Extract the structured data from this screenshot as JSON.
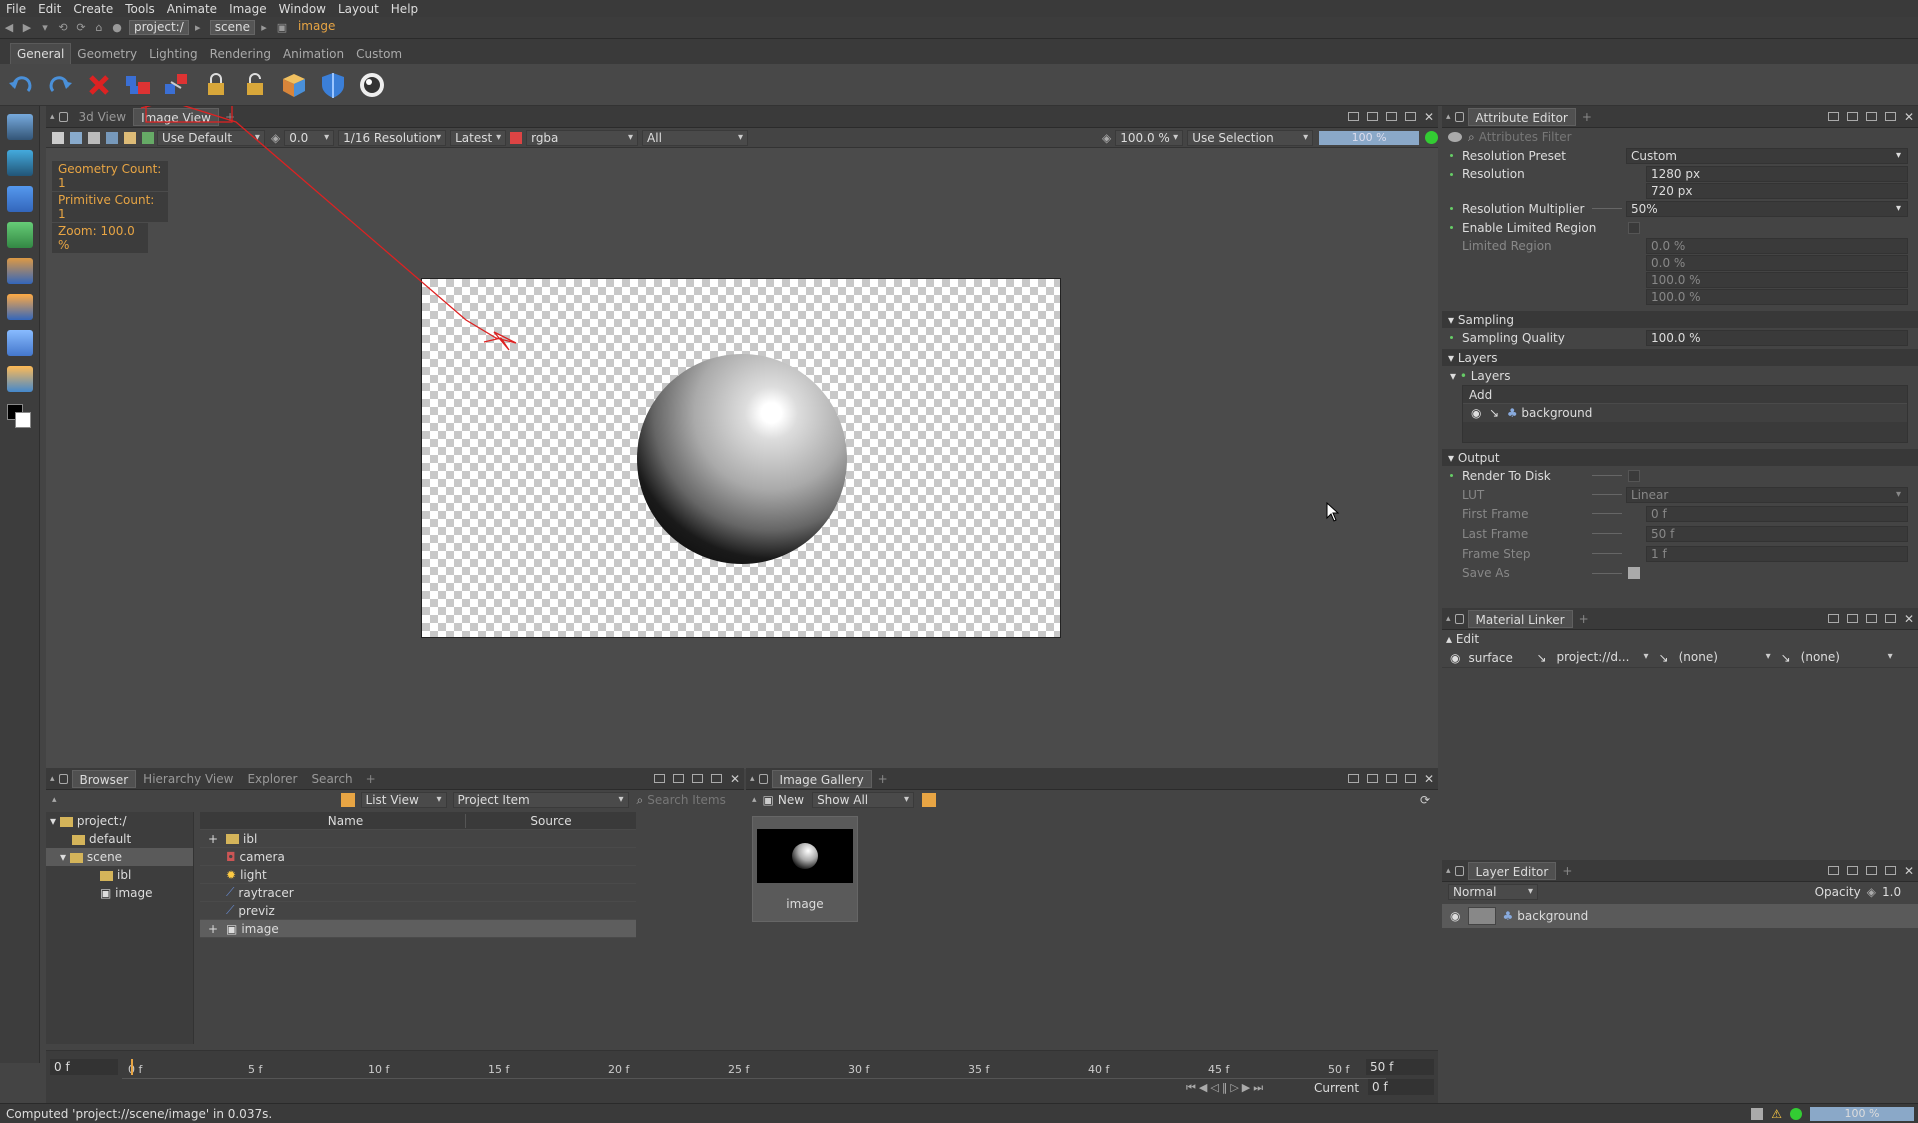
{
  "menu": [
    "File",
    "Edit",
    "Create",
    "Tools",
    "Animate",
    "Image",
    "Window",
    "Layout",
    "Help"
  ],
  "breadcrumb": [
    "project:/",
    "scene",
    "image"
  ],
  "shelf_tabs": [
    "General",
    "Geometry",
    "Lighting",
    "Rendering",
    "Animation",
    "Custom"
  ],
  "viewport": {
    "tabs": [
      "3d View",
      "Image View"
    ],
    "toolbar": {
      "camera": "Use Default",
      "exposure": "0.0",
      "resolution": "1/16 Resolution",
      "version": "Latest",
      "channels": "rgba",
      "layer": "All",
      "zoom": "100.0 %",
      "selection": "Use Selection",
      "progress": "100 %"
    },
    "info": [
      "Geometry Count: 1",
      "Primitive Count: 1",
      "Zoom: 100.0 %"
    ]
  },
  "attr": {
    "tab": "Attribute Editor",
    "filter_placeholder": "Attributes Filter",
    "resolution_preset_label": "Resolution Preset",
    "resolution_preset": "Custom",
    "resolution_label": "Resolution",
    "res_w": "1280 px",
    "res_h": "720 px",
    "multiplier_label": "Resolution Multiplier",
    "multiplier": "50%",
    "limited_enable_label": "Enable Limited Region",
    "limited_label": "Limited Region",
    "limited": [
      "0.0 %",
      "0.0 %",
      "100.0 %",
      "100.0 %"
    ],
    "sampling_section": "Sampling",
    "sampling_label": "Sampling Quality",
    "sampling": "100.0 %",
    "layers_section": "Layers",
    "layers_sub": "Layers",
    "add": "Add",
    "layer_item": "background",
    "output_section": "Output",
    "render_disk_label": "Render To Disk",
    "lut_label": "LUT",
    "lut": "Linear",
    "first_frame_label": "First Frame",
    "first_frame": "0 f",
    "last_frame_label": "Last Frame",
    "last_frame": "50 f",
    "frame_step_label": "Frame Step",
    "frame_step": "1 f",
    "save_as_label": "Save As"
  },
  "matlinker": {
    "tab": "Material Linker",
    "edit": "Edit",
    "surface": "surface",
    "project": "project://d...",
    "none1": "(none)",
    "none2": "(none)"
  },
  "layereditor": {
    "tab": "Layer Editor",
    "blend": "Normal",
    "opacity_label": "Opacity",
    "opacity": "1.0",
    "layer": "background"
  },
  "browser": {
    "tabs": [
      "Browser",
      "Hierarchy View",
      "Explorer",
      "Search"
    ],
    "view": "List View",
    "filter": "Project Item",
    "search_placeholder": "Search Items",
    "tree": [
      "project:/",
      "default",
      "scene",
      "ibl",
      "image"
    ],
    "col_name": "Name",
    "col_source": "Source",
    "items": [
      "ibl",
      "camera",
      "light",
      "raytracer",
      "previz",
      "image"
    ]
  },
  "gallery": {
    "tab": "Image Gallery",
    "new": "New",
    "show": "Show All",
    "thumb_label": "image"
  },
  "timeline": {
    "start": "0 f",
    "end": "50 f",
    "ticks": [
      "0 f",
      "5 f",
      "10 f",
      "15 f",
      "20 f",
      "25 f",
      "30 f",
      "35 f",
      "40 f",
      "45 f",
      "50 f"
    ],
    "current_label": "Current",
    "current": "0 f"
  },
  "status": {
    "message": "Computed 'project://scene/image' in 0.037s.",
    "zoom": "100 %"
  }
}
